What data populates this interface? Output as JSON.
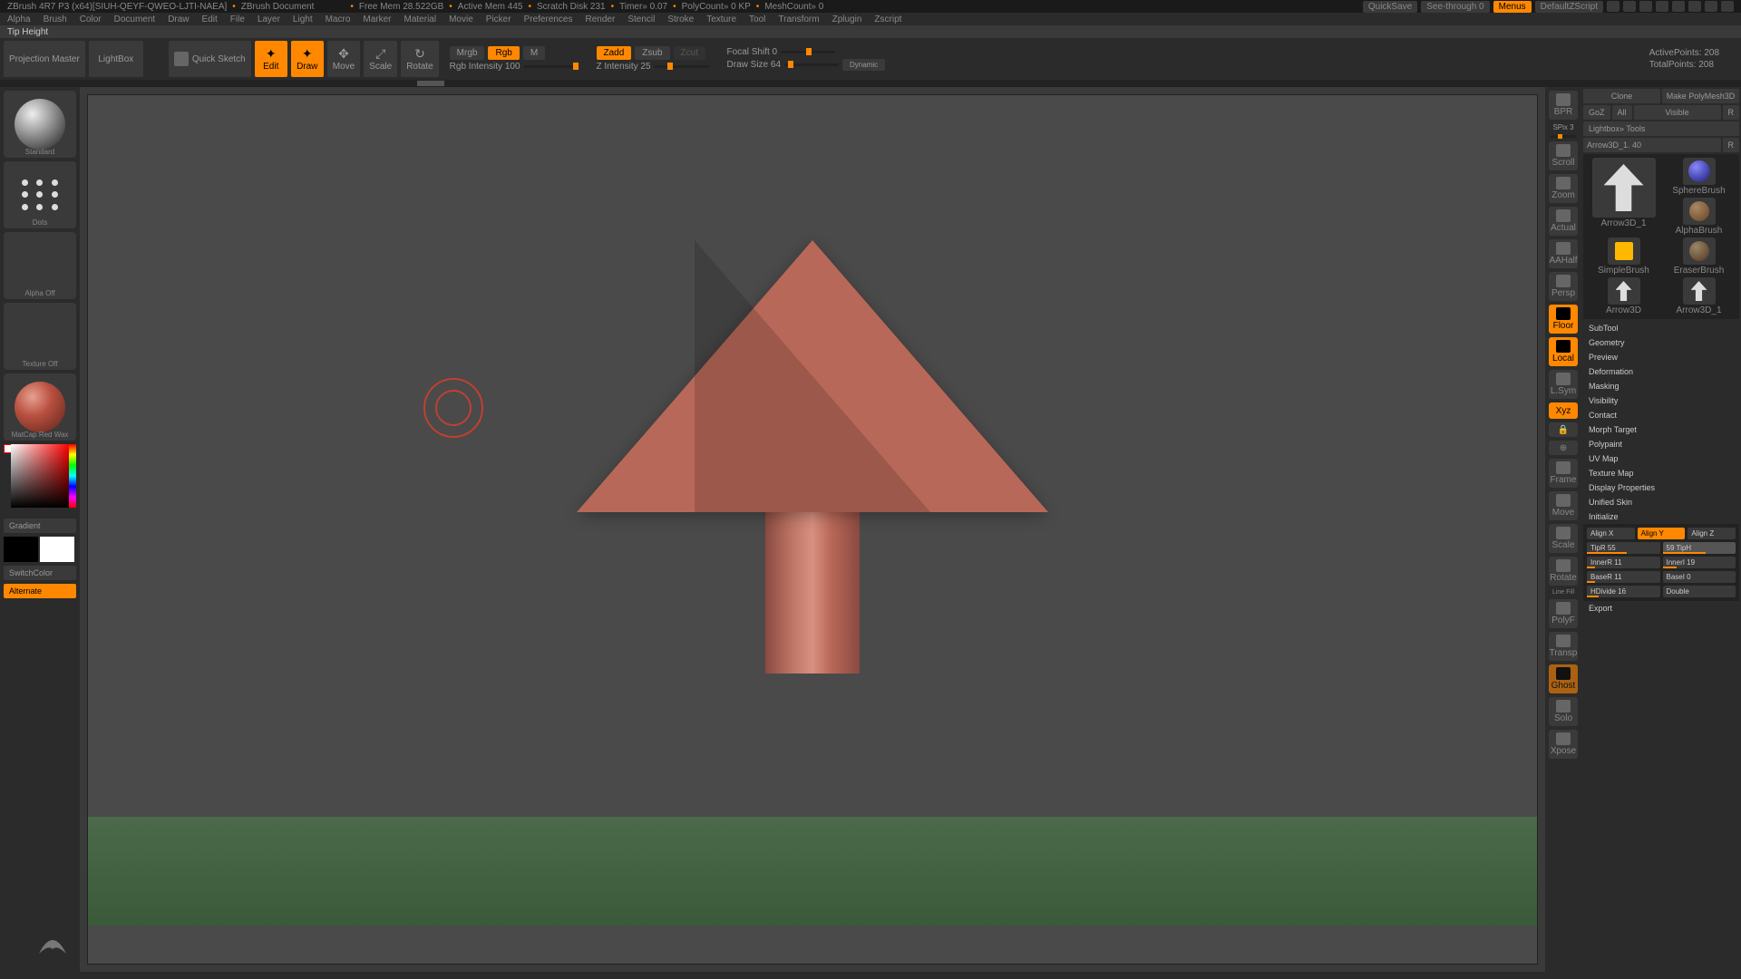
{
  "titlebar": {
    "app": "ZBrush 4R7 P3 (x64)[SIUH-QEYF-QWEO-LJTI-NAEA]",
    "doc": "ZBrush Document",
    "free_mem": "Free Mem 28.522GB",
    "active_mem": "Active Mem 445",
    "scratch": "Scratch Disk 231",
    "timer": "Timer» 0.07",
    "polycount": "PolyCount» 0 KP",
    "meshcount": "MeshCount» 0",
    "quicksave": "QuickSave",
    "seethrough": "See-through  0",
    "menus": "Menus",
    "defaultscript": "DefaultZScript"
  },
  "menubar": [
    "Alpha",
    "Brush",
    "Color",
    "Document",
    "Draw",
    "Edit",
    "File",
    "Layer",
    "Light",
    "Macro",
    "Marker",
    "Material",
    "Movie",
    "Picker",
    "Preferences",
    "Render",
    "Stencil",
    "Stroke",
    "Texture",
    "Tool",
    "Transform",
    "Zplugin",
    "Zscript"
  ],
  "status": "Tip Height",
  "toolbar": {
    "projection": "Projection Master",
    "lightbox": "LightBox",
    "quicksketch": "Quick Sketch",
    "edit": "Edit",
    "draw": "Draw",
    "move": "Move",
    "scale": "Scale",
    "rotate": "Rotate",
    "mrgb": "Mrgb",
    "rgb": "Rgb",
    "m": "M",
    "rgb_intensity": "Rgb Intensity 100",
    "zadd": "Zadd",
    "zsub": "Zsub",
    "zcut": "Zcut",
    "z_intensity": "Z Intensity 25",
    "focal_shift": "Focal Shift 0",
    "draw_size": "Draw Size 64",
    "dynamic": "Dynamic",
    "active_points": "ActivePoints: 208",
    "total_points": "TotalPoints: 208"
  },
  "left": {
    "brush": "Standard",
    "stroke": "Dots",
    "alpha": "Alpha Off",
    "texture": "Texture Off",
    "material": "MatCap Red Wax",
    "gradient": "Gradient",
    "switch": "SwitchColor",
    "alternate": "Alternate"
  },
  "right_strip": {
    "spix": "SPix 3",
    "items": [
      "BPR",
      "Scroll",
      "Zoom",
      "Actual",
      "AAHalf",
      "Persp",
      "Floor",
      "Local",
      "L.Sym",
      "Xyz",
      "",
      "",
      "Frame",
      "Move",
      "Scale",
      "Rotate",
      "Line Fill",
      "PolyF",
      "Transp",
      "Ghost",
      "Solo",
      "Xpose"
    ]
  },
  "right_panel": {
    "row1": {
      "goz": "GoZ",
      "all": "All",
      "visible": "Visible",
      "r": "R"
    },
    "row2": {
      "clone": "Clone",
      "make": "Make PolyMesh3D"
    },
    "breadcrumb": "Lightbox» Tools",
    "tool_name": "Arrow3D_1. 40",
    "r_btn": "R",
    "tools": [
      "Arrow3D_1",
      "SphereBrush",
      "AlphaBrush",
      "SimpleBrush",
      "EraserBrush",
      "Arrow3D",
      "Arrow3D_1"
    ],
    "sections": [
      "SubTool",
      "Geometry",
      "Preview",
      "Deformation",
      "Masking",
      "Visibility",
      "Contact",
      "Morph Target",
      "Polypaint",
      "UV Map",
      "Texture Map",
      "Display Properties",
      "Unified Skin",
      "Initialize",
      "Export"
    ],
    "init": {
      "align_x": "Align X",
      "align_y": "Align Y",
      "align_z": "Align Z",
      "tipr": "TipR 55",
      "tiph": "59 TipH",
      "innerr": "InnerR 11",
      "innerl": "InnerI 19",
      "baser": "BaseR 11",
      "basei": "BaseI 0",
      "hdivide": "HDivide 16",
      "double": "Double"
    }
  }
}
